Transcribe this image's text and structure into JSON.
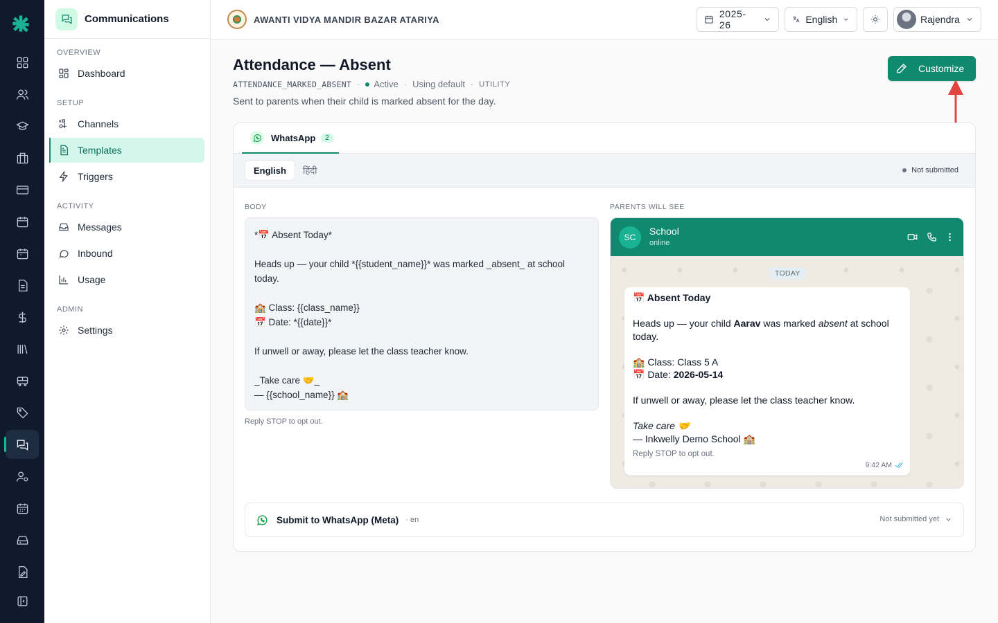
{
  "sidebar": {
    "title": "Communications",
    "sections": {
      "overview": "OVERVIEW",
      "setup": "SETUP",
      "activity": "ACTIVITY",
      "admin": "ADMIN"
    },
    "items": {
      "dashboard": "Dashboard",
      "channels": "Channels",
      "templates": "Templates",
      "triggers": "Triggers",
      "messages": "Messages",
      "inbound": "Inbound",
      "usage": "Usage",
      "settings": "Settings"
    }
  },
  "topbar": {
    "school_name": "AWANTI VIDYA MANDIR BAZAR ATARIYA",
    "year": "2025-26",
    "language": "English",
    "user": "Rajendra"
  },
  "page": {
    "title": "Attendance — Absent",
    "code": "ATTENDANCE_MARKED_ABSENT",
    "status": "Active",
    "source": "Using default",
    "category": "UTILITY",
    "description": "Sent to parents when their child is marked absent for the day.",
    "customize_label": "Customize"
  },
  "tabs": {
    "whatsapp_label": "WhatsApp",
    "whatsapp_count": "2"
  },
  "languages": {
    "active": "English",
    "other": "हिंदी",
    "status": "Not submitted"
  },
  "body": {
    "label": "BODY",
    "text": "*📅 Absent Today*\n\nHeads up — your child *{{student_name}}* was marked _absent_ at school today.\n\n🏫 Class: {{class_name}}\n📅 Date: *{{date}}*\n\nIf unwell or away, please let the class teacher know.\n\n_Take care 🤝_\n— {{school_name}} 🏫",
    "footer": "Reply STOP to opt out."
  },
  "preview": {
    "label": "PARENTS WILL SEE",
    "contact_initials": "SC",
    "contact_name": "School",
    "contact_status": "online",
    "day_chip": "TODAY",
    "line_title": "📅 Absent Today",
    "line_heads_pre": "Heads up — your child ",
    "student_name": "Aarav",
    "line_heads_mid": " was marked ",
    "absent_word": "absent",
    "line_heads_post": " at school today.",
    "line_class": "🏫 Class: Class 5 A",
    "line_date_pre": "📅 Date: ",
    "date_value": "2026-05-14",
    "line_unwell": "If unwell or away, please let the class teacher know.",
    "line_takecare": "Take care 🤝",
    "line_school": "— Inkwelly Demo School 🏫",
    "footer": "Reply STOP to opt out.",
    "time": "9:42 AM"
  },
  "submit": {
    "title": "Submit to WhatsApp (Meta)",
    "lang_code": "· en",
    "status": "Not submitted yet"
  },
  "colors": {
    "accent": "#0f8a6f",
    "rail": "#0f1b2d",
    "arrow": "#e0463f"
  }
}
